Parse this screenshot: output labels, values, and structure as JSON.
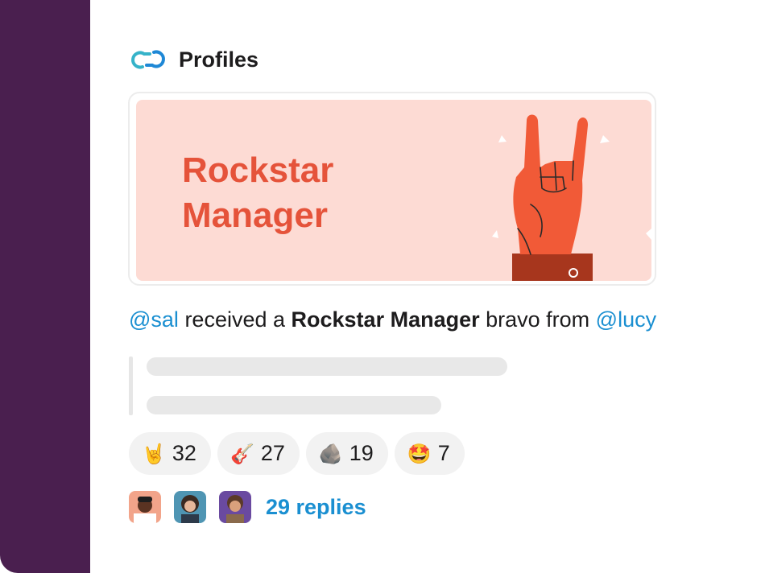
{
  "app": {
    "title": "Profiles",
    "logo_icon": "chain-link-icon"
  },
  "colors": {
    "sidebar": "#4a1f4f",
    "banner_bg": "#fddbd4",
    "banner_text": "#e5533a",
    "mention": "#1a8fd1"
  },
  "banner": {
    "title": "Rockstar Manager",
    "icon": "rock-on-hand-icon"
  },
  "message": {
    "recipient": "@sal",
    "text_received": " received a ",
    "award": "Rockstar Manager",
    "text_bravo": " bravo from ",
    "sender": "@lucy"
  },
  "reactions": [
    {
      "icon": "rock-on-hand-emoji",
      "emoji": "🤘",
      "count": "32"
    },
    {
      "icon": "guitar-emoji",
      "emoji": "🎸",
      "count": "27"
    },
    {
      "icon": "rock-emoji",
      "emoji": "🪨",
      "count": "19"
    },
    {
      "icon": "star-struck-emoji",
      "emoji": "🤩",
      "count": "7"
    }
  ],
  "replies": {
    "label": "29 replies",
    "avatars": [
      "avatar-1",
      "avatar-2",
      "avatar-3"
    ]
  }
}
